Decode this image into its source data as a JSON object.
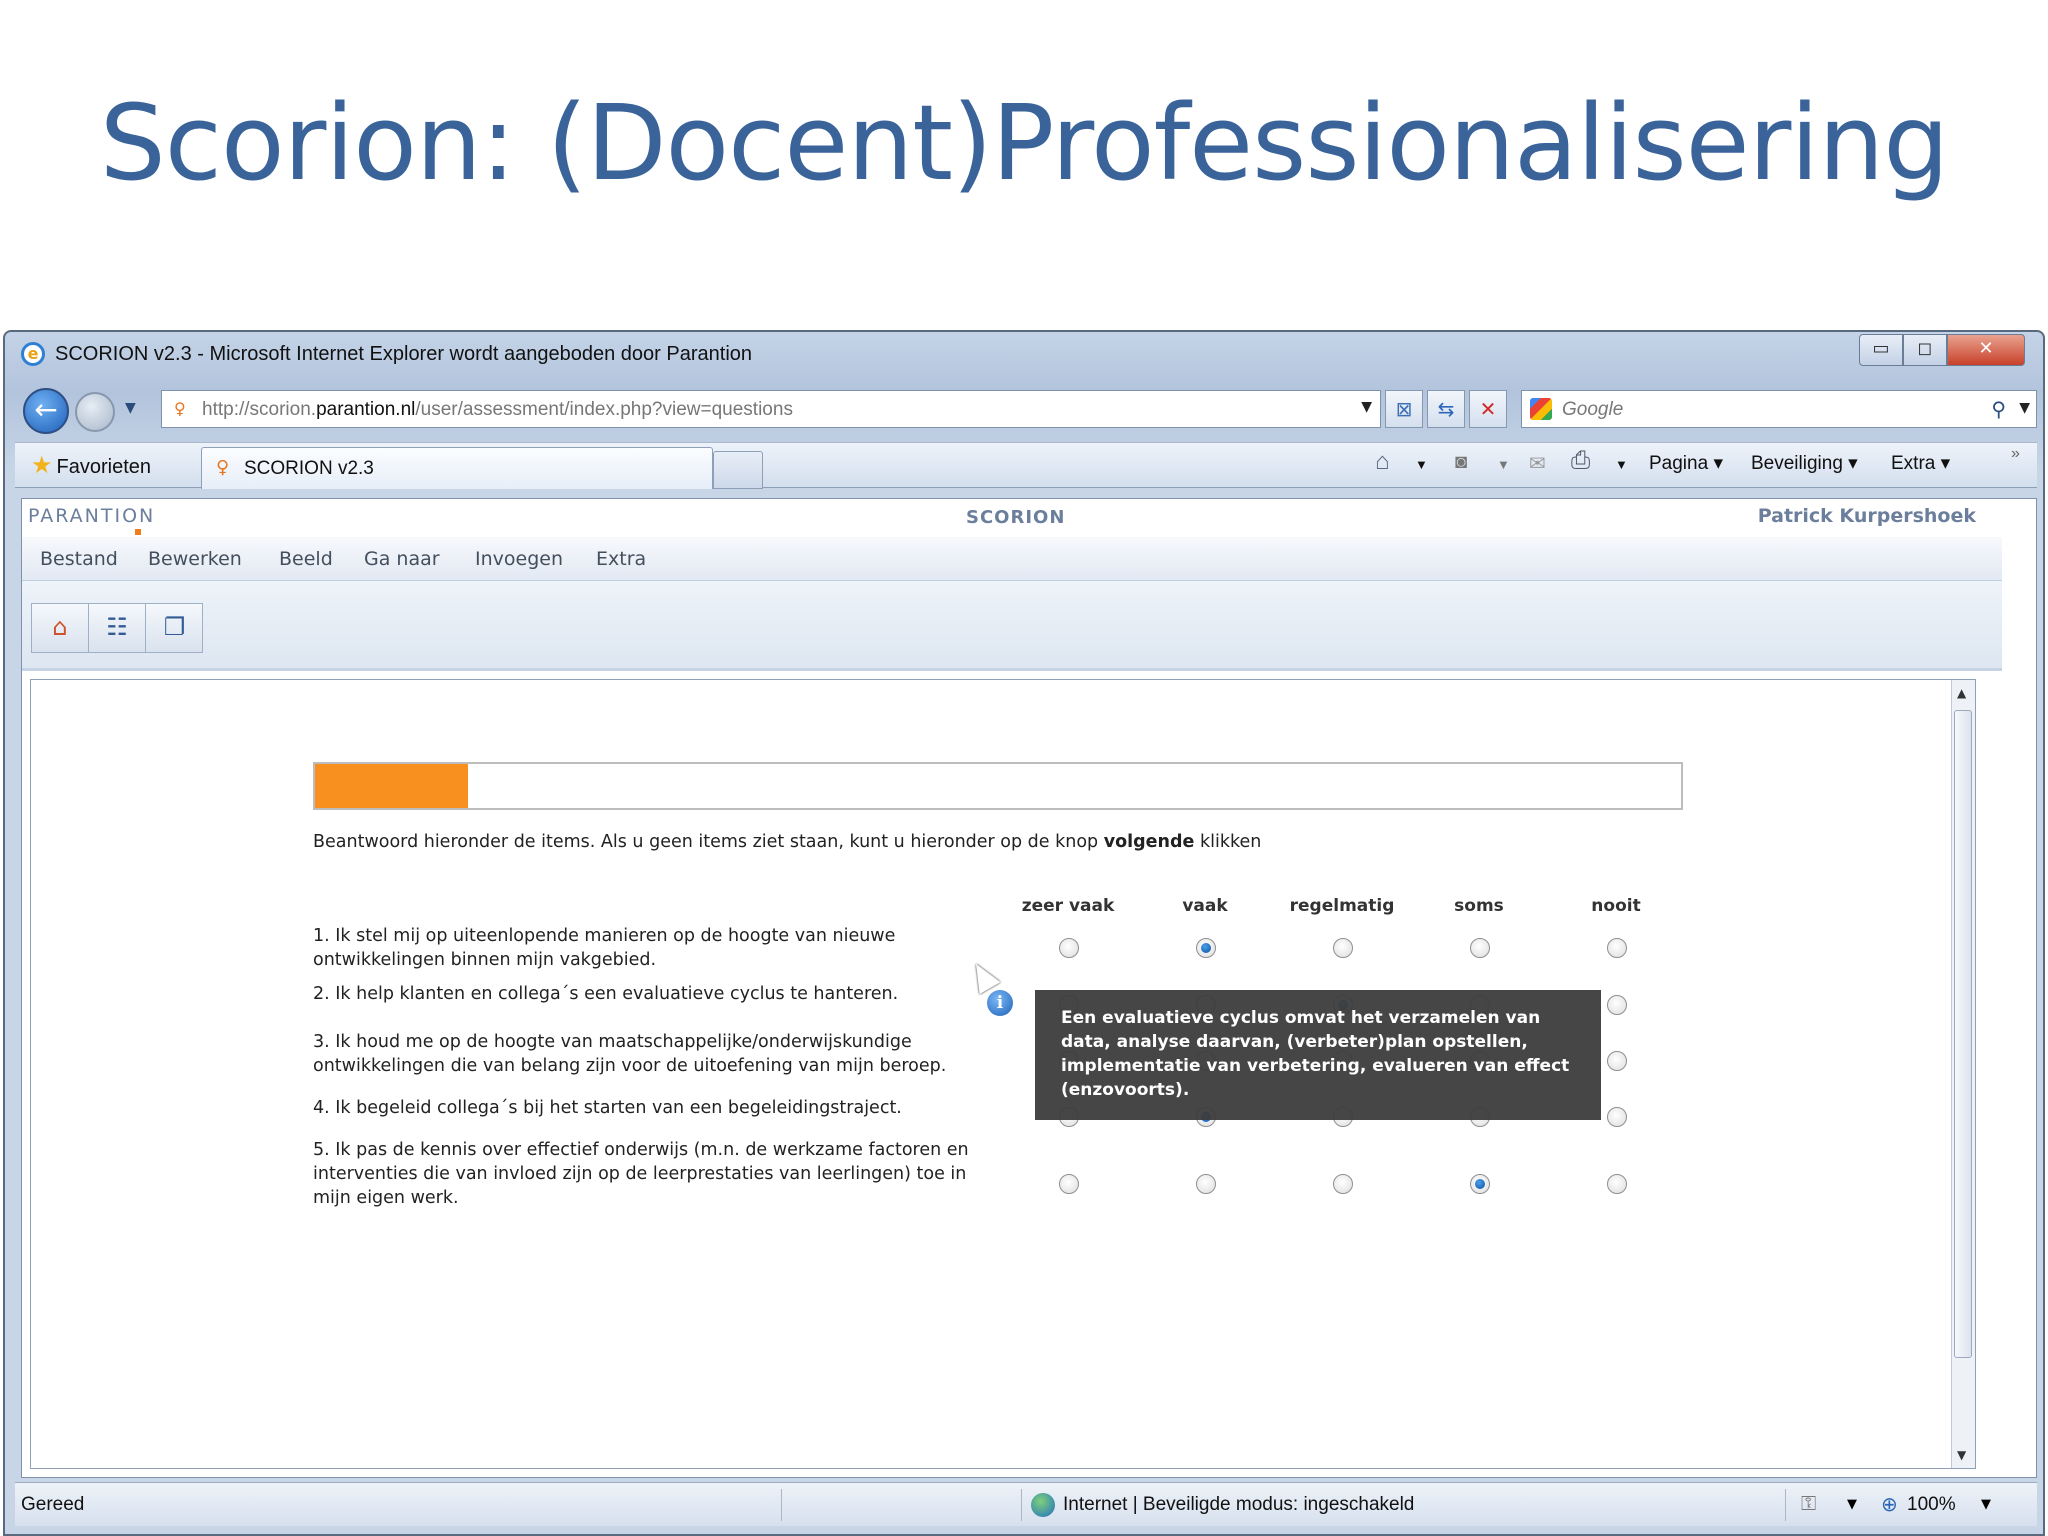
{
  "slide": {
    "title": "Scorion: (Docent)Professionalisering"
  },
  "window": {
    "title": "SCORION v2.3 - Microsoft Internet Explorer wordt aangeboden door Parantion",
    "controls": {
      "minimize": "▭",
      "maximize": "◻",
      "close": "✕"
    }
  },
  "nav": {
    "url_prefix": "http://scorion.",
    "url_domain": "parantion.nl",
    "url_path": "/user/assessment/index.php?view=questions",
    "search_placeholder": "Google"
  },
  "tabs": {
    "favorites_label": "Favorieten",
    "active_tab": "SCORION v2.3"
  },
  "commandbar": {
    "pagina": "Pagina ▾",
    "beveiliging": "Beveiliging ▾",
    "extra": "Extra ▾"
  },
  "app": {
    "brand": "PARANTION",
    "name": "SCORION",
    "user": "Patrick Kurpershoek",
    "menu": [
      "Bestand",
      "Bewerken",
      "Beeld",
      "Ga naar",
      "Invoegen",
      "Extra"
    ],
    "toolbar_icons": [
      "home-icon",
      "list-icon",
      "copy-icon"
    ]
  },
  "survey": {
    "progress_fraction": 0.112,
    "instruction_before": "Beantwoord hieronder de items. Als u geen items ziet staan, kunt u hieronder op de knop ",
    "instruction_bold": "volgende",
    "instruction_after": " klikken",
    "columns": [
      "zeer vaak",
      "vaak",
      "regelmatig",
      "soms",
      "nooit"
    ],
    "questions": [
      {
        "text": "1. Ik stel mij op uiteenlopende manieren op de hoogte van nieuwe ontwikkelingen binnen mijn vakgebied.",
        "selected": 1
      },
      {
        "text": "2. Ik help klanten en collega´s een evaluatieve cyclus te hanteren.",
        "selected": 2
      },
      {
        "text": "3. Ik houd me op de hoogte van maatschappelijke/onderwijskundige ontwikkelingen die van belang zijn voor de uitoefening van mijn beroep.",
        "selected": -1
      },
      {
        "text": "4. Ik begeleid collega´s bij het starten van een begeleidingstraject.",
        "selected": 1
      },
      {
        "text": "5. Ik pas de kennis over effectief onderwijs (m.n. de werkzame factoren en interventies die van invloed zijn op de leerprestaties van leerlingen) toe in mijn eigen werk.",
        "selected": 3
      }
    ],
    "tooltip": "Een evaluatieve cyclus omvat het verzamelen van data, analyse daarvan, (verbeter)plan opstellen, implementatie van verbetering, evalueren van effect (enzovoorts)."
  },
  "status": {
    "text": "Gereed",
    "zone": "Internet | Beveiligde modus: ingeschakeld",
    "zoom": "100%"
  }
}
